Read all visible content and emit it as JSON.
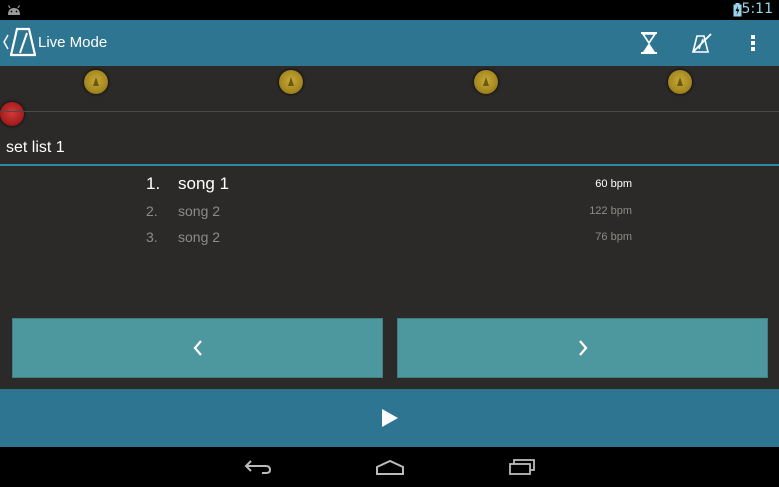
{
  "status_bar": {
    "time": "5:11"
  },
  "action_bar": {
    "title": "Live Mode",
    "icons": [
      "metronome-logo",
      "hourglass-icon",
      "mute-icon",
      "overflow-menu-icon"
    ]
  },
  "beat_indicators": {
    "count": 4,
    "accent_color": "#a88b22",
    "playhead_color": "#a91f1f"
  },
  "set_list": {
    "name": "set list 1"
  },
  "songs": [
    {
      "number": "1.",
      "name": "song 1",
      "bpm": "60 bpm",
      "active": true
    },
    {
      "number": "2.",
      "name": "song 2",
      "bpm": "122 bpm",
      "active": false
    },
    {
      "number": "3.",
      "name": "song 2",
      "bpm": "76 bpm",
      "active": false
    }
  ],
  "controls": {
    "previous": "previous-icon",
    "next": "next-icon",
    "play": "play-icon"
  },
  "system_nav": [
    "back-icon",
    "home-icon",
    "recent-apps-icon"
  ],
  "colors": {
    "action_bar": "#2e7591",
    "nav_button": "#4d989f",
    "background": "#2b2a28"
  }
}
